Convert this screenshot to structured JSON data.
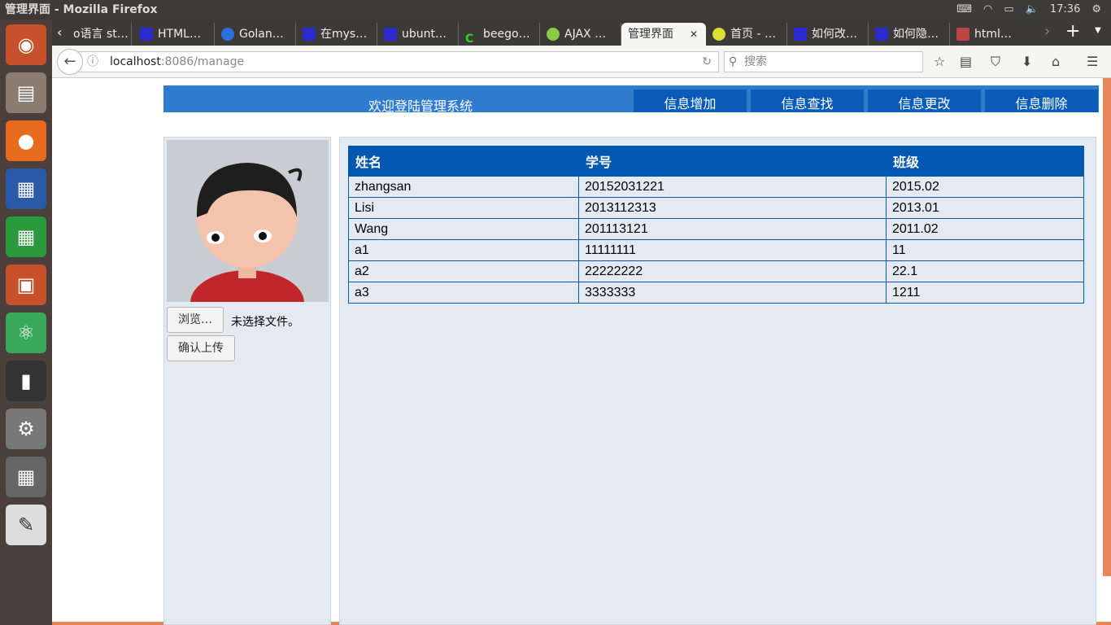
{
  "os": {
    "window_title": "管理界面 - Mozilla Firefox",
    "clock": "17:36"
  },
  "browser": {
    "tabs": [
      {
        "label": "o语言 st…"
      },
      {
        "label": "HTML…"
      },
      {
        "label": "Golan…"
      },
      {
        "label": "在mys…"
      },
      {
        "label": "ubunt…"
      },
      {
        "label": "beego…"
      },
      {
        "label": "AJAX …"
      },
      {
        "label": "管理界面"
      },
      {
        "label": "首页 - …"
      },
      {
        "label": "如何改…"
      },
      {
        "label": "如何隐…"
      },
      {
        "label": "html…"
      }
    ],
    "url_host": "localhost",
    "url_rest": ":8086/manage",
    "search_placeholder": "搜索"
  },
  "page": {
    "header_title": "欢迎登陆管理系统",
    "nav": [
      {
        "label": "信息增加"
      },
      {
        "label": "信息查找"
      },
      {
        "label": "信息更改"
      },
      {
        "label": "信息删除"
      }
    ],
    "browse_label": "浏览…",
    "no_file": "未选择文件。",
    "upload_label": "确认上传",
    "table": {
      "headers": [
        "姓名",
        "学号",
        "班级"
      ],
      "rows": [
        [
          "zhangsan",
          "20152031221",
          "2015.02"
        ],
        [
          "Lisi",
          "2013112313",
          "2013.01"
        ],
        [
          "Wang",
          "201113121",
          "2011.02"
        ],
        [
          "a1",
          "11111111",
          "11"
        ],
        [
          "a2",
          "22222222",
          "22.1"
        ],
        [
          "a3",
          "3333333",
          "1211"
        ]
      ]
    }
  }
}
